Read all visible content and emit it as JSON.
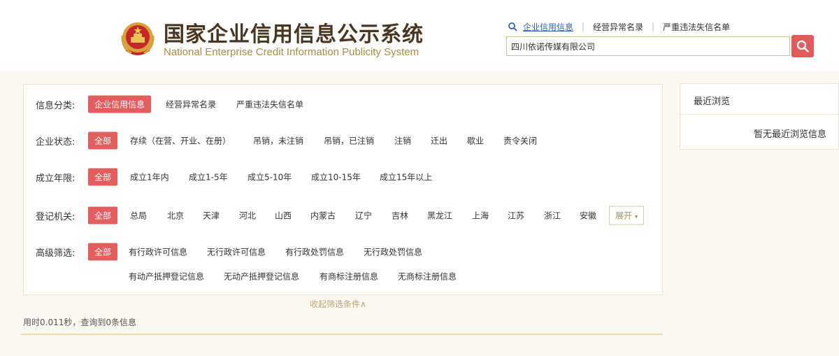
{
  "header": {
    "title": "国家企业信用信息公示系统",
    "subtitle": "National Enterprise Credit Information Publicity System",
    "emblem_icon": "national-emblem-icon",
    "search_tabs": [
      {
        "label": "企业信用信息",
        "active": true
      },
      {
        "label": "经营异常名录",
        "active": false
      },
      {
        "label": "严重违法失信名单",
        "active": false
      }
    ],
    "search_value": "四川依诺传媒有限公司",
    "search_button_icon": "search-icon"
  },
  "filters": {
    "info_category": {
      "label": "信息分类:",
      "options": [
        "企业信用信息",
        "经营异常名录",
        "严重违法失信名单"
      ],
      "selected": "企业信用信息"
    },
    "enterprise_status": {
      "label": "企业状态:",
      "options": [
        "全部",
        "存续（在营、开业、在册）",
        "吊销，未注销",
        "吊销，已注销",
        "注销",
        "迁出",
        "歇业",
        "责令关闭"
      ],
      "selected": "全部"
    },
    "established_years": {
      "label": "成立年限:",
      "options": [
        "全部",
        "成立1年内",
        "成立1-5年",
        "成立5-10年",
        "成立10-15年",
        "成立15年以上"
      ],
      "selected": "全部"
    },
    "registration_authority": {
      "label": "登记机关:",
      "options": [
        "全部",
        "总局",
        "北京",
        "天津",
        "河北",
        "山西",
        "内蒙古",
        "辽宁",
        "吉林",
        "黑龙江",
        "上海",
        "江苏",
        "浙江",
        "安徽"
      ],
      "selected": "全部",
      "expand_label": "展开",
      "expand_icon": "caret-down-icon"
    },
    "advanced": {
      "label": "高级筛选:",
      "options_row1": [
        "全部",
        "有行政许可信息",
        "无行政许可信息",
        "有行政处罚信息",
        "无行政处罚信息"
      ],
      "options_row2": [
        "有动产抵押登记信息",
        "无动产抵押登记信息",
        "有商标注册信息",
        "无商标注册信息"
      ],
      "selected": "全部"
    },
    "collapse_label": "收起筛选条件∧"
  },
  "result_info": "用时0.011秒，查询到0条信息",
  "recent": {
    "title": "最近浏览",
    "empty_text": "暂无最近浏览信息"
  },
  "colors": {
    "accent_red": "#e35d5d",
    "link_blue": "#2f5fb3",
    "title_brown": "#4a3520",
    "subtitle_gold": "#b08a3e",
    "background": "#fbf8f1"
  }
}
